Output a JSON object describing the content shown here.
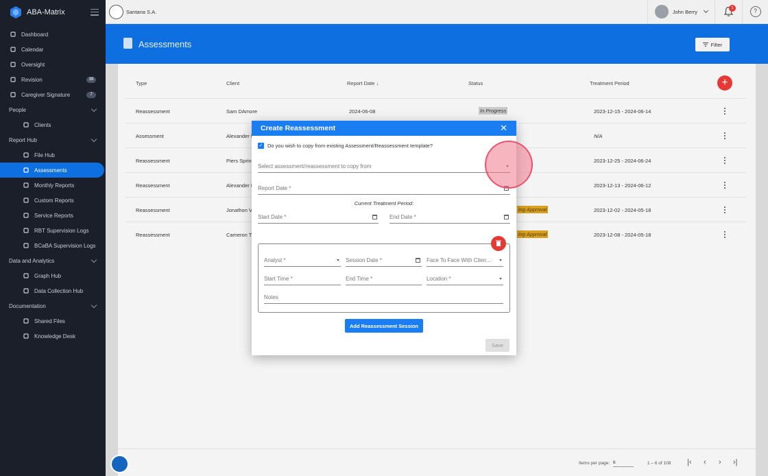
{
  "app": {
    "name": "ABA-Matrix"
  },
  "topbar": {
    "org": "Santana S.A.",
    "user": "John Berry",
    "notifications": "1",
    "help": "?"
  },
  "sidebar": {
    "items": [
      {
        "label": "Dashboard",
        "icon": "dashboard-icon"
      },
      {
        "label": "Calendar",
        "icon": "calendar-icon"
      },
      {
        "label": "Oversight",
        "icon": "eye-icon"
      },
      {
        "label": "Revision",
        "icon": "document-icon",
        "badge": "39"
      },
      {
        "label": "Caregiver Signature",
        "icon": "pen-icon",
        "badge": "7"
      },
      {
        "label": "People",
        "section": true
      },
      {
        "label": "Clients",
        "icon": "person-icon",
        "sub": true
      },
      {
        "label": "Report Hub",
        "section": true
      },
      {
        "label": "File Hub",
        "icon": "cloud-icon",
        "sub": true
      },
      {
        "label": "Assessments",
        "icon": "clipboard-icon",
        "sub": true,
        "active": true
      },
      {
        "label": "Monthly Reports",
        "icon": "report-icon",
        "sub": true
      },
      {
        "label": "Custom Reports",
        "icon": "report-icon",
        "sub": true
      },
      {
        "label": "Service Reports",
        "icon": "report-icon",
        "sub": true
      },
      {
        "label": "RBT Supervision Logs",
        "icon": "log-icon",
        "sub": true
      },
      {
        "label": "BCaBA Supervision Logs",
        "icon": "log-icon",
        "sub": true
      },
      {
        "label": "Data and Analytics",
        "section": true
      },
      {
        "label": "Graph Hub",
        "icon": "chart-icon",
        "sub": true
      },
      {
        "label": "Data Collection Hub",
        "icon": "collection-icon",
        "sub": true
      },
      {
        "label": "Documentation",
        "section": true
      },
      {
        "label": "Shared Files",
        "icon": "share-icon",
        "sub": true
      },
      {
        "label": "Knowledge Desk",
        "icon": "graduation-icon",
        "sub": true
      }
    ]
  },
  "page": {
    "title": "Assessments",
    "filter_label": "Filter"
  },
  "table": {
    "headers": {
      "type": "Type",
      "client": "Client",
      "report_date": "Report Date",
      "status": "Status",
      "treatment_period": "Treatment Period"
    },
    "rows": [
      {
        "type": "Reassessment",
        "client": "Sam DAmore",
        "date": "2024-06-08",
        "status": "In Progress",
        "period": "2023-12-15 - 2024-06-14"
      },
      {
        "type": "Assessment",
        "client": "Alexander M",
        "date": "",
        "status": "",
        "period": "N/A"
      },
      {
        "type": "Reassessment",
        "client": "Piers Sprin",
        "date": "",
        "status": "",
        "period": "2023-12-25 - 2024-06-24"
      },
      {
        "type": "Reassessment",
        "client": "Alexander M",
        "date": "",
        "status": "",
        "period": "2023-12-13 - 2024-06-12"
      },
      {
        "type": "Reassessment",
        "client": "Jonathon V",
        "date": "",
        "status": "ing Approval",
        "period": "2023-12-02 - 2024-05-18"
      },
      {
        "type": "Reassessment",
        "client": "Cameron T",
        "date": "",
        "status": "ing Approval",
        "period": "2023-12-08 - 2024-05-18"
      }
    ],
    "pager": {
      "items_per_page_label": "Items per page:",
      "items_per_page": "6",
      "range": "1 – 6 of 108"
    }
  },
  "modal": {
    "title": "Create Reassessment",
    "copy_checkbox": "Do you wish to copy from existing Assessment/Reassessment template?",
    "copy_select_placeholder": "Select assessment/reassessment to copy from",
    "report_date": "Report Date *",
    "current_treatment_period": "Current Treatment Period:",
    "start_date": "Start Date *",
    "end_date": "End Date *",
    "session": {
      "analyst": "Analyst *",
      "session_date": "Session Date *",
      "face_to_face": "Face To Face With Clien...",
      "start_time": "Start Time *",
      "end_time": "End Time *",
      "location": "Location *",
      "notes": "Notes"
    },
    "add_session_label": "Add Reassessment Session",
    "save_label": "Save"
  }
}
